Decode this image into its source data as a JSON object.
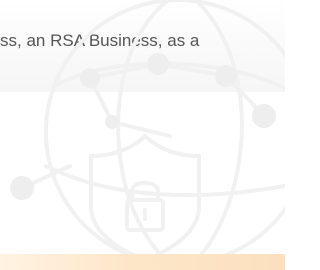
{
  "banner": {
    "text": "ss, an RSA Business, as a"
  },
  "hero": {
    "icon": "globe-network-shield-lock-icon",
    "colors": {
      "line": "#f1f1f1",
      "node": "#eeeeee"
    }
  },
  "bottom_strip": {
    "text": "",
    "colors": {
      "start": "#fff3e2",
      "end": "#fbe0bf"
    }
  }
}
